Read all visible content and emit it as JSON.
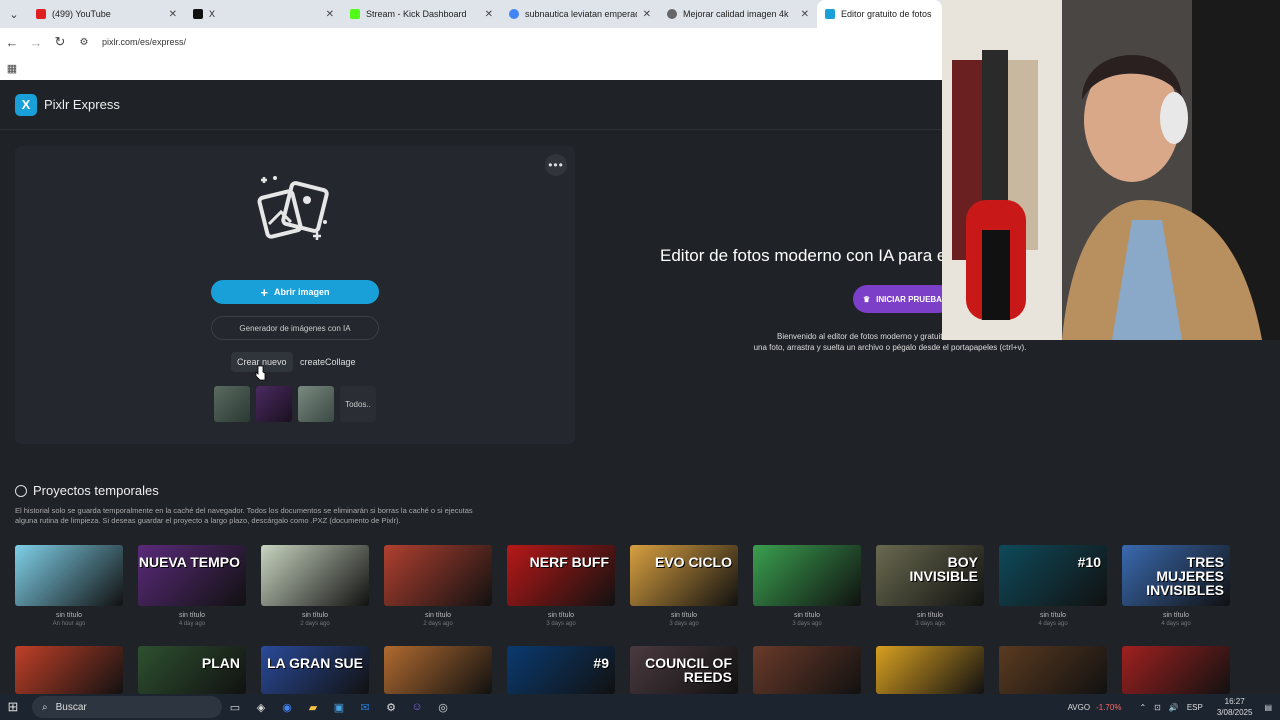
{
  "browser": {
    "tabs": [
      {
        "label": "(499) YouTube",
        "color": "#e02020"
      },
      {
        "label": "X",
        "color": "#111111"
      },
      {
        "label": "Stream - Kick Dashboard",
        "color": "#53fc18"
      },
      {
        "label": "subnautica leviatan emperador",
        "color": "#4285f4"
      },
      {
        "label": "Mejorar calidad imagen 4k",
        "color": "#666666"
      },
      {
        "label": "Editor gratuito de fotos con",
        "color": "#1aa0d8"
      }
    ],
    "url": "pixlr.com/es/express/"
  },
  "app": {
    "brand": "Pixlr Express",
    "open_button": "Abrir imagen",
    "generator_button": "Generador de imágenes con IA",
    "create_new": "Crear nuevo",
    "create_collage": "createCollage",
    "all_label": "Todos..",
    "hero_title": "Editor de fotos moderno con IA para e",
    "trial_button": "INICIAR PRUEBA",
    "hero_desc_1": "Bienvenido al editor de fotos moderno y gratuito de Pixlr con IA.",
    "hero_desc_2": "una foto, arrastra y suelta un archivo o pégalo desde el portapapeles (ctrl+v).",
    "projects_title": "Proyectos temporales",
    "projects_desc": "El historial solo se guarda temporalmente en la caché del navegador. Todos los documentos se eliminarán si borras la caché o si ejecutas alguna rutina de limpieza. Si deseas guardar el proyecto a largo plazo, descárgalo como .PXZ (documento de Pixlr).",
    "projects": [
      {
        "name": "sin título",
        "date": "An hour ago",
        "text": "",
        "color": "#7fd0e8"
      },
      {
        "name": "sin título",
        "date": "4 day ago",
        "text": "NUEVA TEMPO",
        "color": "#5a2a7a"
      },
      {
        "name": "sin título",
        "date": "2 days ago",
        "text": "",
        "color": "#c8d4c0"
      },
      {
        "name": "sin título",
        "date": "2 days ago",
        "text": "",
        "color": "#b04030"
      },
      {
        "name": "sin título",
        "date": "3 days ago",
        "text": "NERF BUFF",
        "color": "#b81818"
      },
      {
        "name": "sin título",
        "date": "3 days ago",
        "text": "EVO CICLO",
        "color": "#d8a040"
      },
      {
        "name": "sin título",
        "date": "3 days ago",
        "text": "",
        "color": "#3aa050"
      },
      {
        "name": "sin título",
        "date": "3 days ago",
        "text": "BOY INVISIBLE",
        "color": "#6a6a50"
      },
      {
        "name": "sin título",
        "date": "4 days ago",
        "text": "#10",
        "color": "#0e4a5a"
      },
      {
        "name": "sin título",
        "date": "4 days ago",
        "text": "TRES MUJERES INVISIBLES",
        "color": "#3a6ab0"
      }
    ],
    "second_row": [
      {
        "text": "",
        "color": "#c04028"
      },
      {
        "text": "PLAN",
        "color": "#2e5030"
      },
      {
        "text": "LA GRAN SUE",
        "color": "#2a4a9a"
      },
      {
        "text": "",
        "color": "#b06a30"
      },
      {
        "text": "#9",
        "color": "#0a3a70"
      },
      {
        "text": "COUNCIL OF REEDS",
        "color": "#4a3a40"
      },
      {
        "text": "",
        "color": "#6a3a2a"
      },
      {
        "text": "",
        "color": "#d8a020"
      },
      {
        "text": "",
        "color": "#5a3a20"
      },
      {
        "text": "",
        "color": "#a02020"
      }
    ]
  },
  "taskbar": {
    "search": "Buscar",
    "stock_name": "AVGO",
    "stock_change": "-1.70%",
    "lang": "ESP",
    "time": "16:27",
    "date": "3/08/2025"
  }
}
